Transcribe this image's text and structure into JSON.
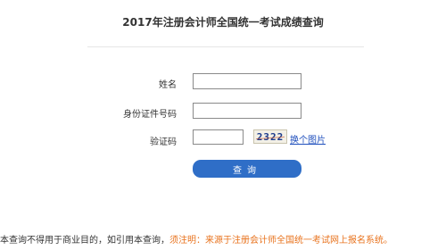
{
  "page": {
    "title": "2017年注册会计师全国统一考试成绩查询"
  },
  "form": {
    "name_label": "姓名",
    "name_value": "",
    "id_label": "身份证件号码",
    "id_value": "",
    "captcha_label": "验证码",
    "captcha_value": "",
    "captcha_image_text": "2322",
    "swap_image_link": "换个图片",
    "submit_label": "查询"
  },
  "footer": {
    "notice": "本查询不得用于商业目的，如引用本查询，",
    "warning": "须注明：来源于注册会计师全国统一考试网上报名系统。"
  },
  "colors": {
    "button": "#2f6ec7",
    "link": "#1f4fbd",
    "warning": "#e8731e"
  }
}
